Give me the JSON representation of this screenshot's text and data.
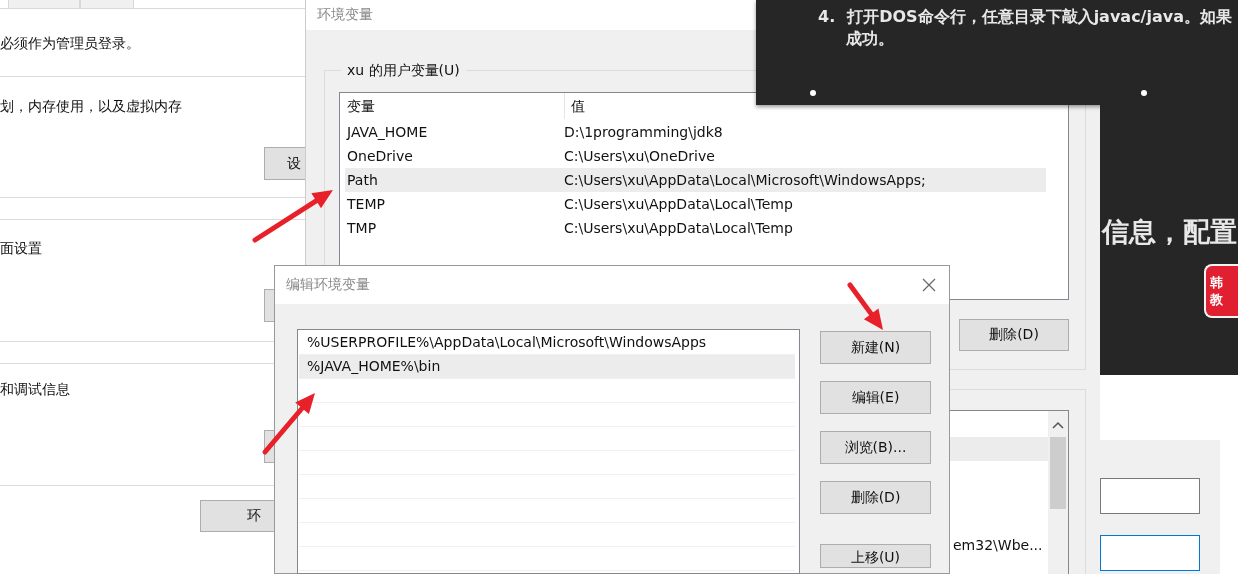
{
  "system_properties": {
    "tabs": [
      {
        "selected": false
      },
      {
        "selected": false
      }
    ],
    "sections": [
      {
        "kind": "note",
        "text": "必须作为管理员登录。"
      },
      {
        "kind": "button_row",
        "text": "划，内存使用，以及虚拟内存",
        "button": "设"
      },
      {
        "kind": "button_row",
        "text": "面设置"
      },
      {
        "kind": "button_row",
        "text": "和调试信息"
      }
    ],
    "footer_button": "环"
  },
  "environment_variables": {
    "title": "环境变量",
    "user_group": {
      "label": "xu 的用户变量(U)",
      "columns": [
        "变量",
        "值"
      ],
      "rows": [
        {
          "name": "JAVA_HOME",
          "value": "D:\\1programming\\jdk8",
          "selected": false
        },
        {
          "name": "OneDrive",
          "value": "C:\\Users\\xu\\OneDrive",
          "selected": false
        },
        {
          "name": "Path",
          "value": "C:\\Users\\xu\\AppData\\Local\\Microsoft\\WindowsApps;",
          "selected": true
        },
        {
          "name": "TEMP",
          "value": "C:\\Users\\xu\\AppData\\Local\\Temp",
          "selected": false
        },
        {
          "name": "TMP",
          "value": "C:\\Users\\xu\\AppData\\Local\\Temp",
          "selected": false
        }
      ],
      "buttons": [
        "删除(D)"
      ]
    },
    "system_list": {
      "rows": [
        {
          "selected": true
        },
        {
          "selected": false
        },
        {
          "selected": false
        },
        {
          "selected": false
        },
        {
          "value": "em32\\Wbe...",
          "selected": false
        }
      ]
    }
  },
  "slide": {
    "number": "4.",
    "line": "打开DOS命令行，任意目录下敲入javac/java。如果",
    "continuation": "成功。",
    "heading": "信息，配置",
    "badge": [
      "韩",
      "教"
    ]
  },
  "edit_dialog": {
    "title": "编辑环境变量",
    "entries": [
      {
        "text": "%USERPROFILE%\\AppData\\Local\\Microsoft\\WindowsApps",
        "selected": false
      },
      {
        "text": "%JAVA_HOME%\\bin",
        "selected": true
      }
    ],
    "buttons": [
      "新建(N)",
      "编辑(E)",
      "浏览(B)...",
      "删除(D)",
      "上移(U)"
    ]
  }
}
